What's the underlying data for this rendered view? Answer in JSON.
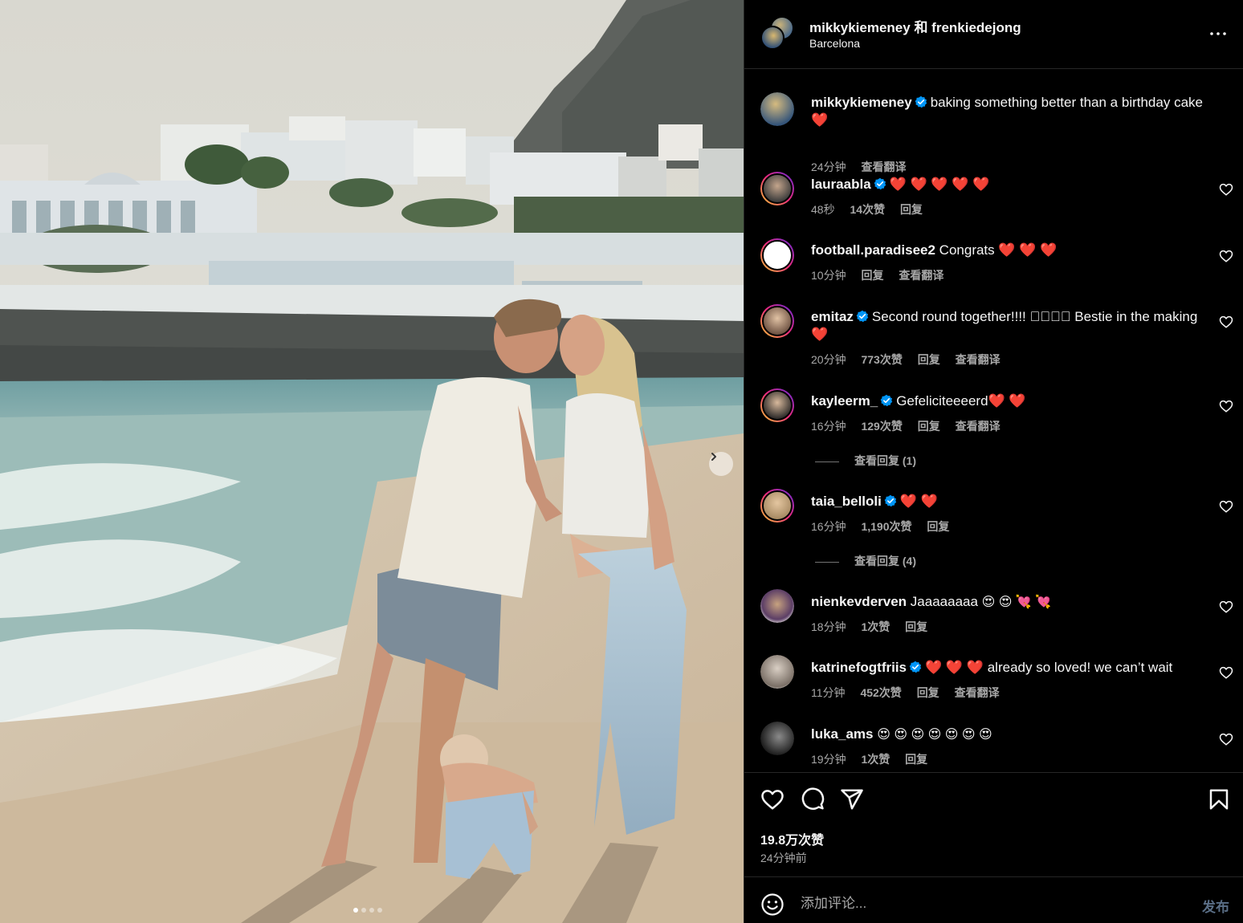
{
  "header": {
    "user1": "mikkykiemeney",
    "joiner": "和",
    "user2": "frenkiedejong",
    "location": "Barcelona"
  },
  "caption": {
    "user": "mikkykiemeney",
    "text": "baking something better than a birthday cake",
    "emoji": "❤️",
    "time": "24分钟",
    "translate": "查看翻译"
  },
  "comments": [
    {
      "user": "lauraabla",
      "text": "",
      "emoji": "❤️ ❤️ ❤️ ❤️ ❤️",
      "time": "48秒",
      "likes": "14次赞",
      "reply": "回复",
      "translate": ""
    },
    {
      "user": "football.paradisee2",
      "text": "Congrats",
      "emoji": "❤️ ❤️ ❤️",
      "time": "10分钟",
      "likes": "",
      "reply": "回复",
      "translate": "查看翻译"
    },
    {
      "user": "emitaz",
      "text": "Second round together!!!! 􀀀􀀀􀀀􀀀 Bestie in the making",
      "emoji": "❤️",
      "time": "20分钟",
      "likes": "773次赞",
      "reply": "回复",
      "translate": "查看翻译"
    },
    {
      "user": "kayleerm_",
      "text": "Gefeliciteeeerd",
      "emoji": "❤️ ❤️",
      "time": "16分钟",
      "likes": "129次赞",
      "reply": "回复",
      "translate": "查看翻译",
      "view_replies": "查看回复 (1)"
    },
    {
      "user": "taia_belloli",
      "text": "",
      "emoji": "❤️ ❤️",
      "time": "16分钟",
      "likes": "1,190次赞",
      "reply": "回复",
      "translate": "",
      "view_replies": "查看回复 (4)"
    },
    {
      "user": "nienkevderven",
      "text": "Jaaaaaaaa",
      "emoji": "😍 😍 💘 💘",
      "time": "18分钟",
      "likes": "1次赞",
      "reply": "回复",
      "translate": ""
    },
    {
      "user": "katrinefogtfriis",
      "text": "already so loved! we can’t wait",
      "emoji": "❤️ ❤️ ❤️",
      "time": "11分钟",
      "likes": "452次赞",
      "reply": "回复",
      "translate": "查看翻译"
    },
    {
      "user": "luka_ams",
      "text": "",
      "emoji": "😍 😍 😍 😍 😍 😍 😍",
      "time": "19分钟",
      "likes": "1次赞",
      "reply": "回复",
      "translate": ""
    }
  ],
  "stats": {
    "likes": "19.8万次赞",
    "posted": "24分钟前"
  },
  "composer": {
    "placeholder": "添加评论...",
    "post": "发布"
  },
  "carousel": {
    "slides": 4,
    "active_slide": 1
  },
  "colors": {
    "background": "#000000",
    "verified": "#0095f6",
    "heart": "#ff3040",
    "post_disabled": "#5a6e86"
  }
}
